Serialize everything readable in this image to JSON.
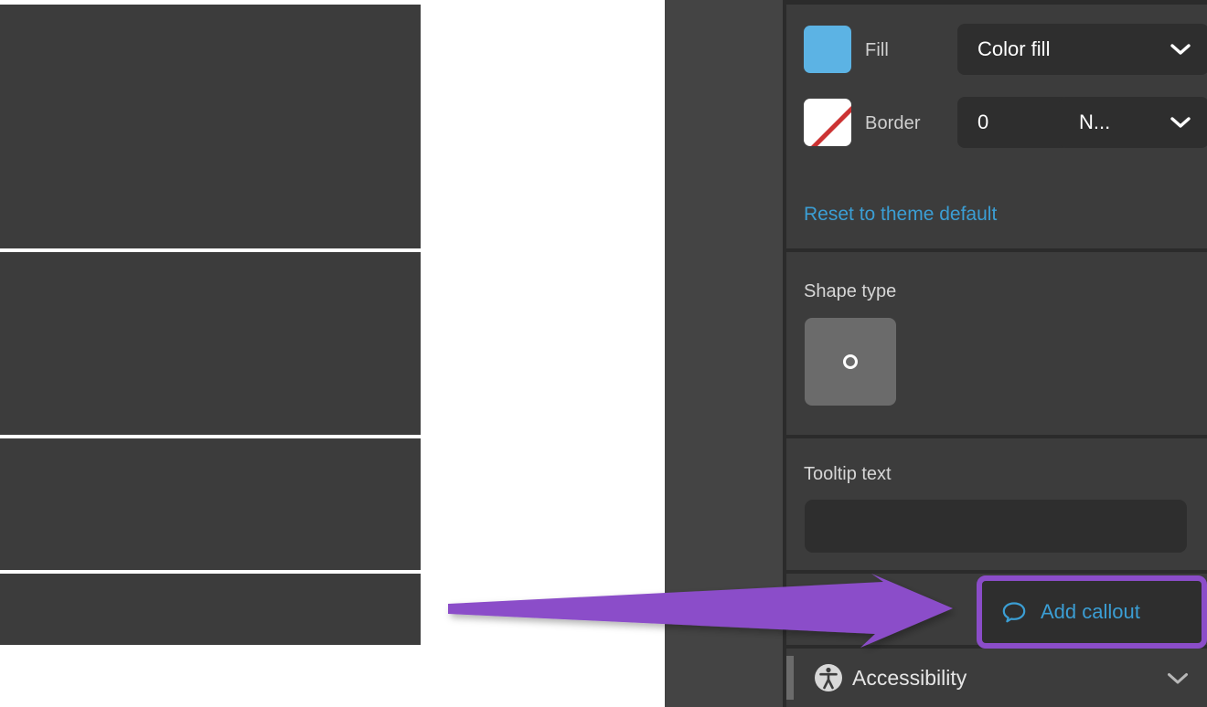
{
  "panel": {
    "style_section": {
      "fill": {
        "label": "Fill",
        "swatch_color": "#5cb3e4",
        "dropdown_value": "Color fill",
        "dropdown_icon": "chevron-down-icon"
      },
      "border": {
        "label": "Border",
        "swatch_color": "#ffffff",
        "swatch_slash_color": "#cc3333",
        "width_value": "0",
        "dropdown_value": "N...",
        "dropdown_icon": "chevron-down-icon"
      },
      "reset_link": "Reset to theme default"
    },
    "shape_type_section": {
      "heading": "Shape type",
      "selected_shape": "circle-outline",
      "swatch_color": "#6b6b6b"
    },
    "tooltip_section": {
      "heading": "Tooltip text",
      "input_value": "",
      "input_placeholder": ""
    },
    "callout_section": {
      "button_label": "Add callout",
      "button_icon": "speech-bubble-icon",
      "label_color": "#3b9ed4",
      "highlight_color": "#8b4dc9"
    },
    "accessibility_section": {
      "label": "Accessibility",
      "icon": "accessibility-person-icon",
      "expand_icon": "chevron-down-icon"
    }
  },
  "annotation": {
    "arrow_color": "#8b4dc9",
    "arrow_direction": "right",
    "points_to": "Add callout"
  },
  "colors": {
    "panel_bg": "#3c3c3c",
    "control_bg": "#2e2e2e",
    "divider": "#2b2b2b",
    "canvas_bg": "#ffffff",
    "mid_panel_bg": "#444444",
    "link_blue": "#3b9ed4",
    "accent_purple": "#8b4dc9"
  }
}
